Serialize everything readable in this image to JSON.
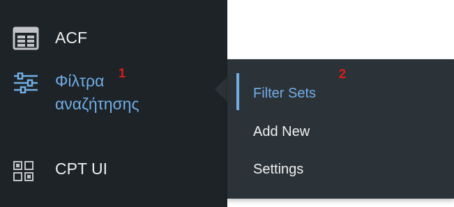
{
  "colors": {
    "sidebar_bg": "#1d2327",
    "submenu_bg": "#2c3338",
    "accent": "#72aee6",
    "text": "#f0f0f1",
    "badge": "#e11a1a"
  },
  "sidebar": {
    "items": [
      {
        "label": "ACF",
        "icon": "table-grid-icon"
      },
      {
        "label_line1": "Φίλτρα",
        "label_line2": "αναζήτησης",
        "icon": "sliders-icon",
        "badge": "1"
      },
      {
        "label": "CPT UI",
        "icon": "squares-grid-icon"
      }
    ]
  },
  "submenu": {
    "items": [
      {
        "label": "Filter Sets",
        "active": true,
        "badge": "2"
      },
      {
        "label": "Add New"
      },
      {
        "label": "Settings"
      }
    ]
  }
}
